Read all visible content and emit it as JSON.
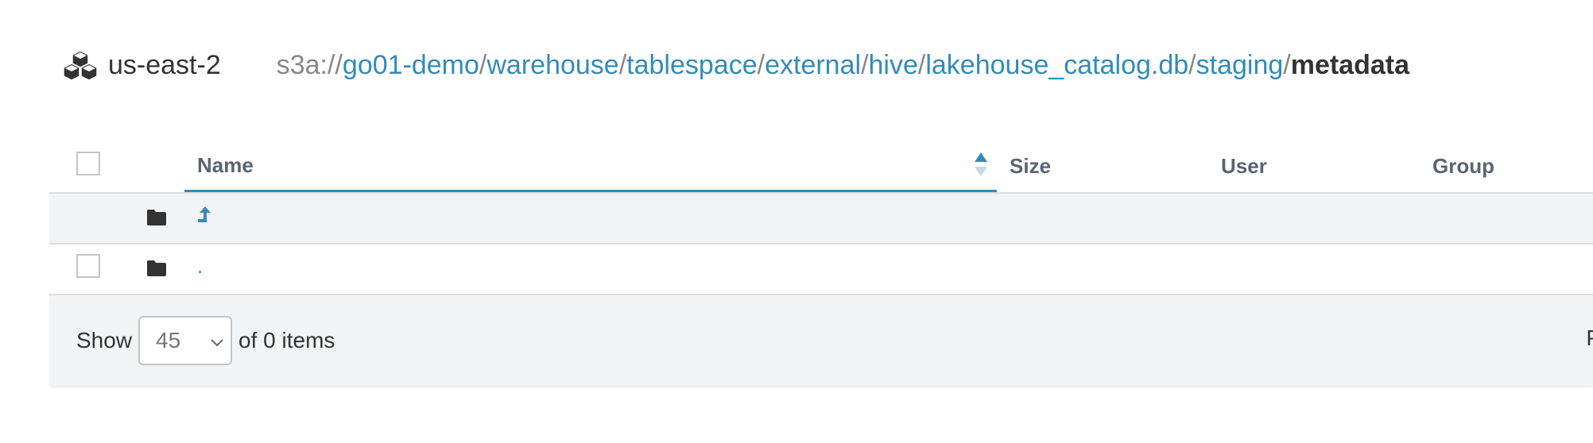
{
  "header": {
    "region": "us-east-2",
    "region_icon": "cubes-icon",
    "path": {
      "scheme": "s3a://",
      "segments": [
        "go01-demo",
        "warehouse",
        "tablespace",
        "external",
        "hive",
        "lakehouse_catalog.db",
        "staging"
      ],
      "separator": "/",
      "current": "metadata"
    }
  },
  "table": {
    "columns": {
      "name": "Name",
      "size": "Size",
      "user": "User",
      "group": "Group"
    },
    "sort": "name-ascending",
    "rows": [
      {
        "type": "parent",
        "icon": "folder-icon",
        "link_icon": "level-up-icon",
        "text": ""
      },
      {
        "type": "current",
        "icon": "folder-icon",
        "text": "."
      }
    ]
  },
  "footer": {
    "show_label": "Show",
    "page_size": "45",
    "items_label": "of 0 items",
    "page_info_partial": "P"
  },
  "colors": {
    "link": "#338bb8",
    "header_text": "#5a6470",
    "row_alt": "#f2f3f5",
    "border": "#dcdcdc"
  }
}
